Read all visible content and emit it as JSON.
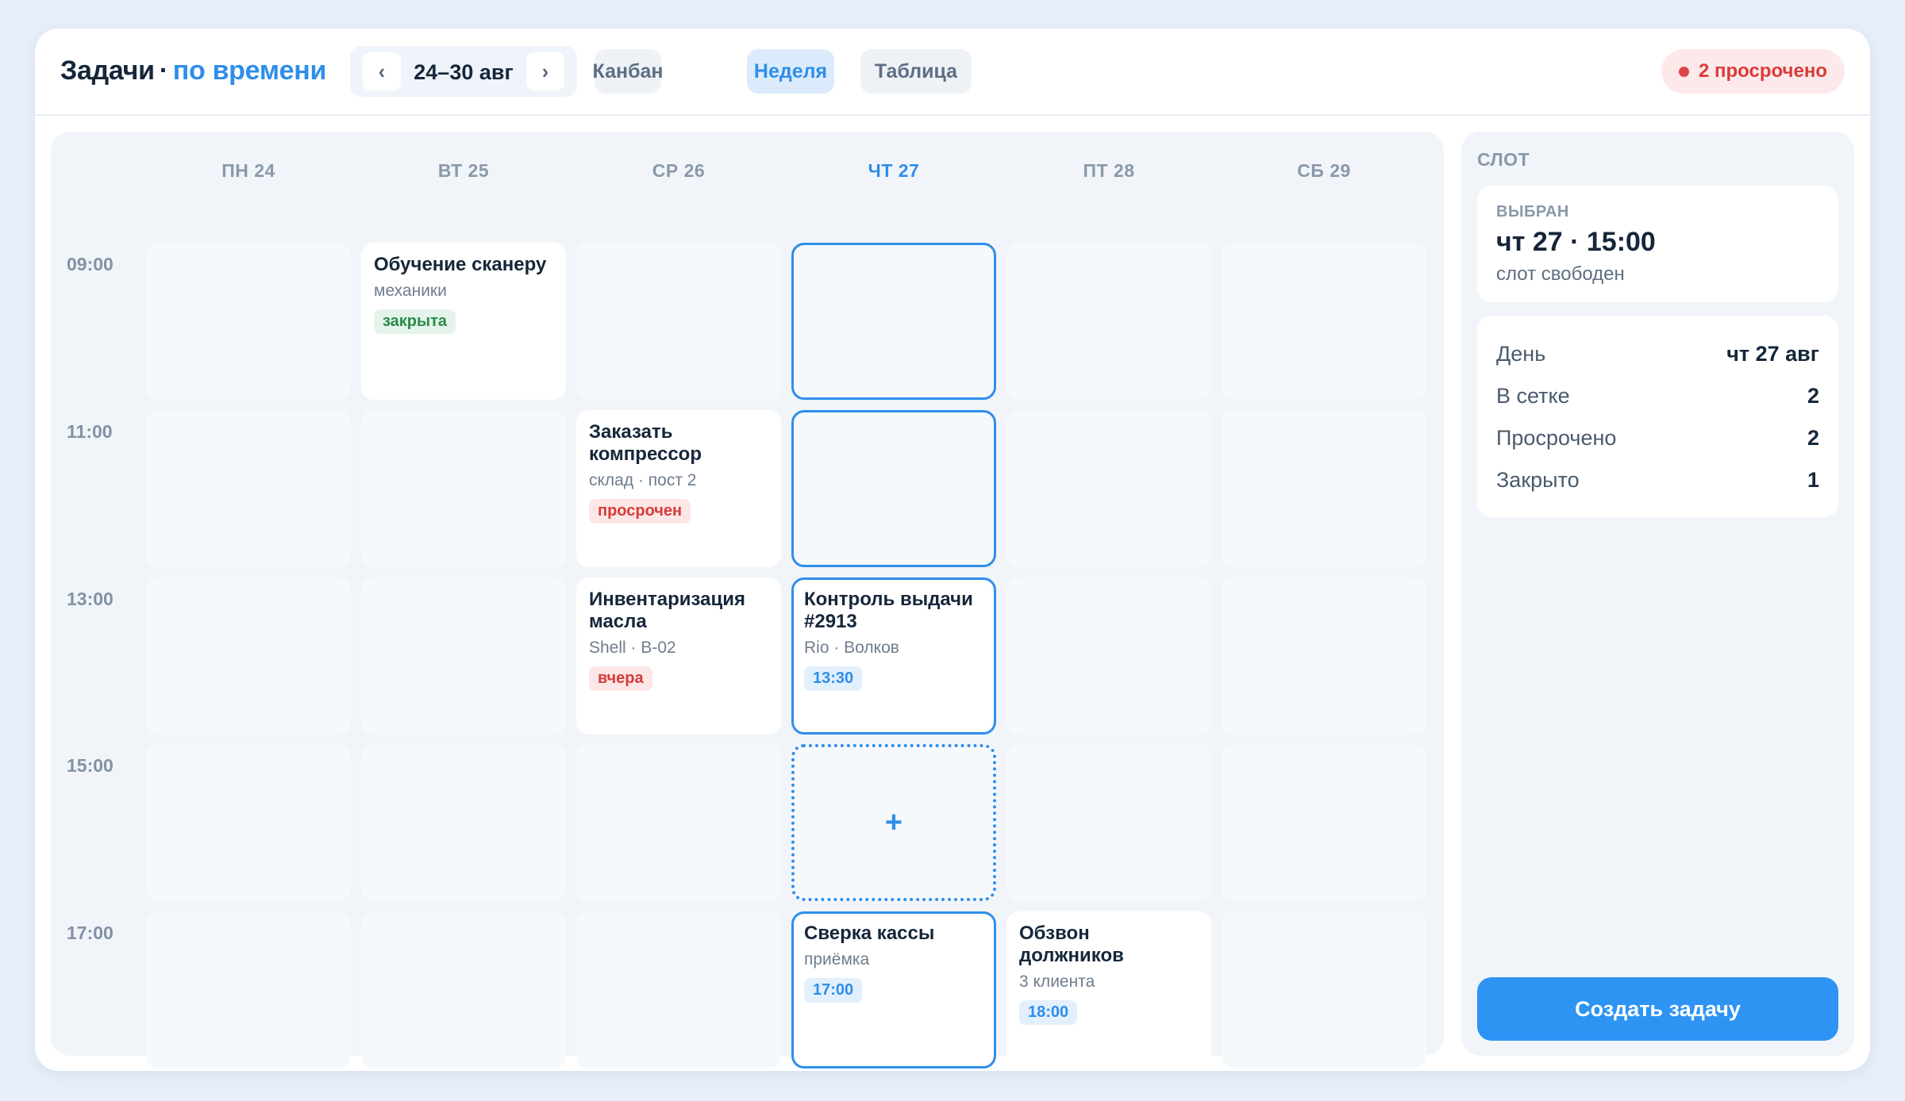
{
  "header": {
    "title": "Задачи",
    "separator": "·",
    "subtitle": "по времени",
    "range_label": "24–30 авг",
    "prev_glyph": "‹",
    "next_glyph": "›",
    "views": [
      "Канбан",
      "Неделя",
      "Таблица"
    ],
    "active_view": "Неделя",
    "overdue_badge": "2 просрочено"
  },
  "days": [
    "ПН 24",
    "ВТ 25",
    "СР 26",
    "ЧТ 27",
    "ПТ 28",
    "СБ 29"
  ],
  "today": "ЧТ 27",
  "times": [
    "09:00",
    "11:00",
    "13:00",
    "15:00",
    "17:00"
  ],
  "tasks": [
    {
      "title": "Обучение сканеру",
      "sub": "механики",
      "tag": "закрыта",
      "tag_color": "#2a8a4b"
    },
    {
      "title": "Заказать компрессор",
      "sub": "склад · пост 2",
      "tag": "просрочен",
      "tag_color": "#d63b3b"
    },
    {
      "title": "Инвентаризация масла",
      "sub": "Shell · B-02",
      "tag": "вчера",
      "tag_color": "#d63b3b"
    },
    {
      "title": "Контроль выдачи #2913",
      "sub": "Rio · Волков",
      "tag": "13:30",
      "tag_color": "#2f8eea"
    },
    {
      "title": "Сверка кассы",
      "sub": "приёмка",
      "tag": "17:00",
      "tag_color": "#2f8eea"
    },
    {
      "title": "Обзвон должников",
      "sub": "3 клиента",
      "tag": "18:00",
      "tag_color": "#2f8eea"
    }
  ],
  "new_slot_glyph": "+",
  "side": {
    "heading": "СЛОТ",
    "selected_label": "ВЫБРАН",
    "selected_value": "чт 27 · 15:00",
    "selected_status": "слот свободен",
    "stats": [
      {
        "label": "День",
        "value": "чт 27 авг"
      },
      {
        "label": "В сетке",
        "value": "2"
      },
      {
        "label": "Просрочено",
        "value": "2"
      },
      {
        "label": "Закрыто",
        "value": "1"
      }
    ],
    "create_button": "Создать задачу"
  },
  "colors": {
    "accent": "#2f8eea",
    "danger": "#d93b3b",
    "success": "#2a8a4b",
    "background": "#e7eff9"
  }
}
